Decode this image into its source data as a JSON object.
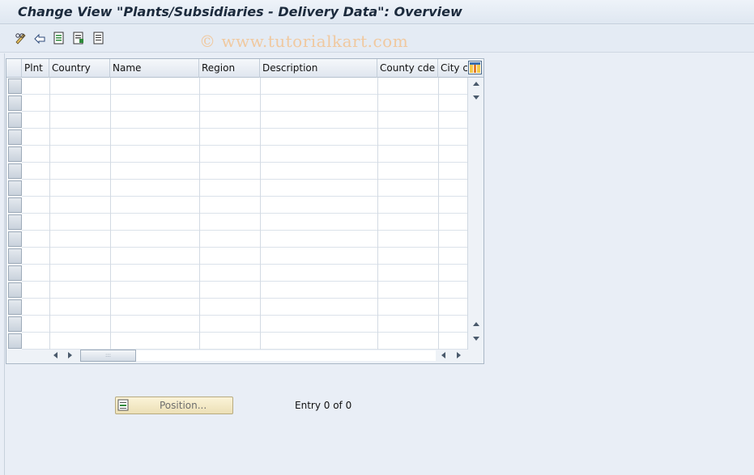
{
  "window": {
    "title": "Change View \"Plants/Subsidiaries - Delivery Data\": Overview"
  },
  "toolbar": {
    "buttons": [
      {
        "icon": "pencil-glasses-icon"
      },
      {
        "icon": "undo-arrow-icon"
      },
      {
        "icon": "document-select-icon"
      },
      {
        "icon": "document-deselect-icon"
      },
      {
        "icon": "document-list-icon"
      }
    ],
    "watermark": "© www.tutorialkart.com"
  },
  "table": {
    "columns": [
      {
        "label": "Plnt"
      },
      {
        "label": "Country"
      },
      {
        "label": "Name"
      },
      {
        "label": "Region"
      },
      {
        "label": "Description"
      },
      {
        "label": "County cde"
      },
      {
        "label": "City cd"
      }
    ],
    "rows": [],
    "column_settings_icon": "table-settings-icon"
  },
  "footer": {
    "position_button": "Position...",
    "entry_text": "Entry 0 of 0"
  },
  "colors": {
    "background": "#e9eef6",
    "watermark": "#f0c9a0",
    "position_button": "#f4e9c4"
  }
}
